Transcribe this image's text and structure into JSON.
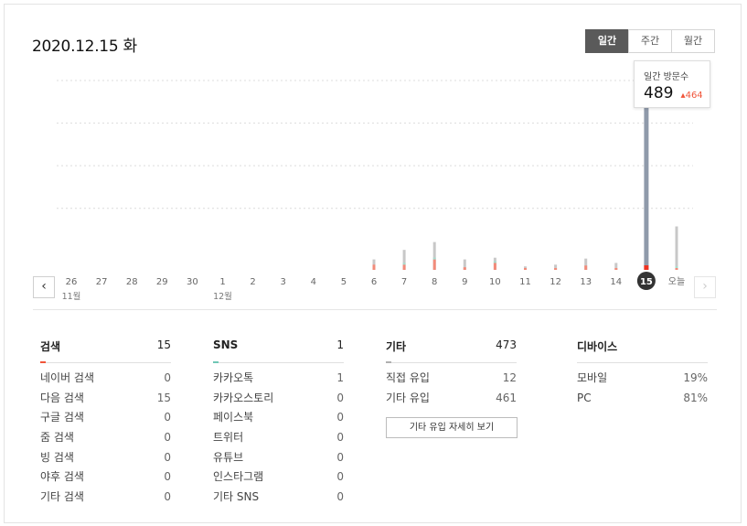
{
  "header": {
    "date": "2020.12.15 화"
  },
  "period_tabs": [
    {
      "label": "일간",
      "active": true
    },
    {
      "label": "주간",
      "active": false
    },
    {
      "label": "월간",
      "active": false
    }
  ],
  "tooltip": {
    "label": "일간 방문수",
    "value": "489",
    "delta": "464",
    "delta_color": "#f0553a"
  },
  "nav": {
    "prev_icon": "chevron-left-icon",
    "next_icon": "chevron-right-icon"
  },
  "chart_data": {
    "type": "bar",
    "categories": [
      "26",
      "27",
      "28",
      "29",
      "30",
      "1",
      "2",
      "3",
      "4",
      "5",
      "6",
      "7",
      "8",
      "9",
      "10",
      "11",
      "12",
      "13",
      "14",
      "15",
      "오늘"
    ],
    "month_labels": [
      {
        "index": 0,
        "label": "11월"
      },
      {
        "index": 5,
        "label": "12월"
      }
    ],
    "selected_index": 19,
    "series": [
      {
        "values": [
          0,
          0,
          0,
          0,
          0,
          0,
          0,
          0,
          0,
          0,
          12,
          23,
          32,
          12,
          14,
          4,
          6,
          13,
          8,
          489,
          50
        ]
      },
      {
        "values": [
          0,
          0,
          0,
          0,
          0,
          0,
          0,
          0,
          0,
          1,
          6,
          6,
          12,
          3,
          8,
          1,
          1,
          5,
          1,
          15,
          1
        ]
      },
      {
        "values": [
          0,
          0,
          0,
          0,
          0,
          0,
          0,
          0,
          0,
          1,
          0,
          1,
          2,
          0,
          1,
          0,
          0,
          0,
          0,
          1,
          1
        ]
      }
    ],
    "colors": [
      "#c8c8c8",
      "#f28b7a",
      "#a8dccd"
    ],
    "highlight_color": "#8f9aaa",
    "highlight_mark_color": "#ee3322",
    "gridlines": 4,
    "ylim": [
      0,
      550
    ],
    "grid": true
  },
  "stats": [
    {
      "title": "검색",
      "total": "15",
      "accent": "#f0553a",
      "items": [
        {
          "label": "네이버 검색",
          "value": "0"
        },
        {
          "label": "다음 검색",
          "value": "15"
        },
        {
          "label": "구글 검색",
          "value": "0"
        },
        {
          "label": "줌 검색",
          "value": "0"
        },
        {
          "label": "빙 검색",
          "value": "0"
        },
        {
          "label": "야후 검색",
          "value": "0"
        },
        {
          "label": "기타 검색",
          "value": "0"
        }
      ]
    },
    {
      "title": "SNS",
      "total": "1",
      "accent": "#6fc7b5",
      "items": [
        {
          "label": "카카오톡",
          "value": "1"
        },
        {
          "label": "카카오스토리",
          "value": "0"
        },
        {
          "label": "페이스북",
          "value": "0"
        },
        {
          "label": "트위터",
          "value": "0"
        },
        {
          "label": "유튜브",
          "value": "0"
        },
        {
          "label": "인스타그램",
          "value": "0"
        },
        {
          "label": "기타 SNS",
          "value": "0"
        }
      ]
    },
    {
      "title": "기타",
      "total": "473",
      "accent": "#b0b0b0",
      "items": [
        {
          "label": "직접 유입",
          "value": "12"
        },
        {
          "label": "기타 유입",
          "value": "461"
        }
      ],
      "button": "기타 유입 자세히 보기"
    },
    {
      "title": "디바이스",
      "total": "",
      "accent": "#ffffff",
      "items": [
        {
          "label": "모바일",
          "value": "19%"
        },
        {
          "label": "PC",
          "value": "81%"
        }
      ]
    }
  ]
}
